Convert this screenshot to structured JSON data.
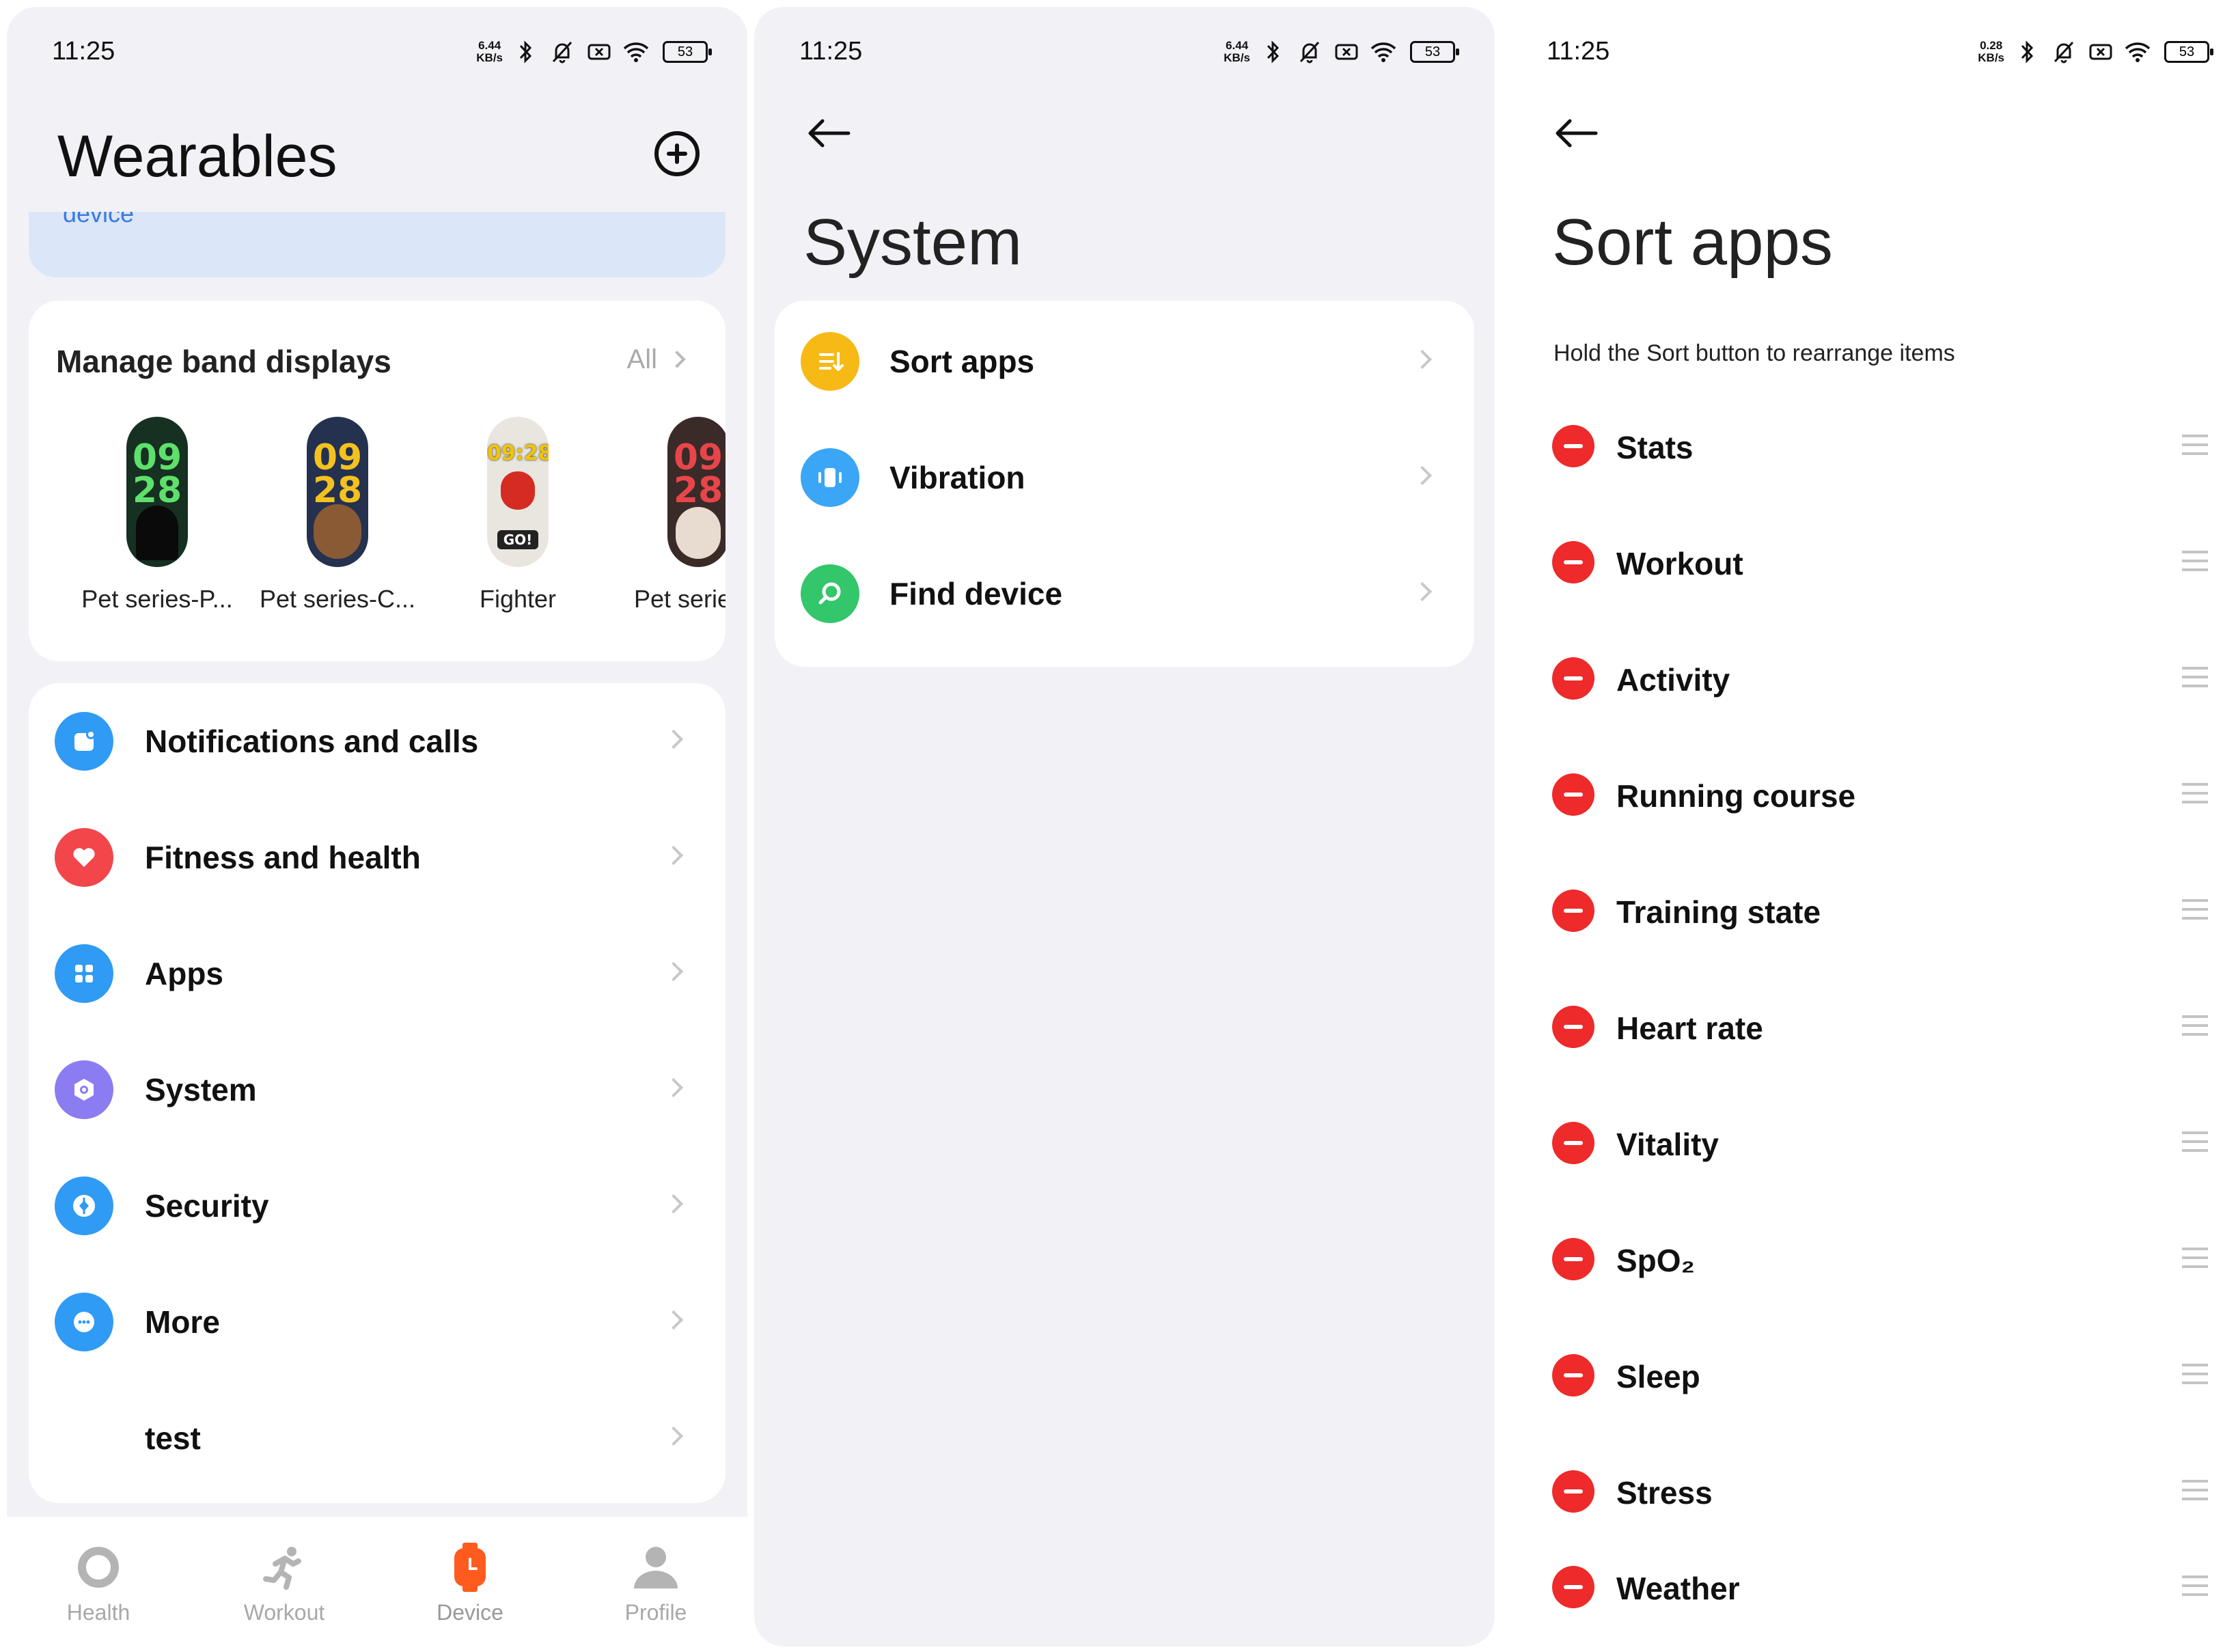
{
  "status_bars": [
    {
      "time": "11:25",
      "speed": "6.44",
      "speed_unit": "KB/s",
      "battery": "53"
    },
    {
      "time": "11:25",
      "speed": "6.44",
      "speed_unit": "KB/s",
      "battery": "53"
    },
    {
      "time": "11:25",
      "speed": "0.28",
      "speed_unit": "KB/s",
      "battery": "53"
    }
  ],
  "wearables": {
    "title": "Wearables",
    "banner_text": "device",
    "band_displays": {
      "title": "Manage band displays",
      "all_label": "All",
      "faces": [
        {
          "label": "Pet series-P...",
          "top": "09",
          "bottom": "28",
          "color": "#5ee06b"
        },
        {
          "label": "Pet series-C...",
          "top": "09",
          "bottom": "28",
          "color": "#f4c21f"
        },
        {
          "label": "Fighter",
          "top": "09:28",
          "bottom": "GO!",
          "color": "#e23b2e"
        },
        {
          "label": "Pet series",
          "top": "09",
          "bottom": "28",
          "color": "#e8454a"
        }
      ]
    },
    "menu": [
      {
        "label": "Notifications and calls",
        "icon": "notification-icon",
        "color": "#2f9bf5"
      },
      {
        "label": "Fitness and health",
        "icon": "heart-icon",
        "color": "#f2464b"
      },
      {
        "label": "Apps",
        "icon": "apps-grid-icon",
        "color": "#2f9bf5"
      },
      {
        "label": "System",
        "icon": "hexagon-icon",
        "color": "#8c7cf2"
      },
      {
        "label": "Security",
        "icon": "shield-icon",
        "color": "#2f9bf5"
      },
      {
        "label": "More",
        "icon": "ellipsis-icon",
        "color": "#2f9bf5"
      },
      {
        "label": "test",
        "icon": "",
        "color": ""
      }
    ],
    "tabs": [
      {
        "label": "Health",
        "icon": "ring-icon",
        "active": false
      },
      {
        "label": "Workout",
        "icon": "runner-icon",
        "active": false
      },
      {
        "label": "Device",
        "icon": "watch-icon",
        "active": true
      },
      {
        "label": "Profile",
        "icon": "person-icon",
        "active": false
      }
    ],
    "accent_color": "#ff5b1f"
  },
  "system": {
    "title": "System",
    "items": [
      {
        "label": "Sort apps",
        "icon": "sort-icon",
        "color": "#f7b915"
      },
      {
        "label": "Vibration",
        "icon": "vibration-icon",
        "color": "#3aa6f5"
      },
      {
        "label": "Find device",
        "icon": "find-device-icon",
        "color": "#33c66a"
      }
    ]
  },
  "sort_apps": {
    "title": "Sort apps",
    "hint": "Hold the Sort button to rearrange items",
    "items": [
      "Stats",
      "Workout",
      "Activity",
      "Running course",
      "Training state",
      "Heart rate",
      "Vitality",
      "SpO₂",
      "Sleep",
      "Stress",
      "Weather"
    ]
  }
}
